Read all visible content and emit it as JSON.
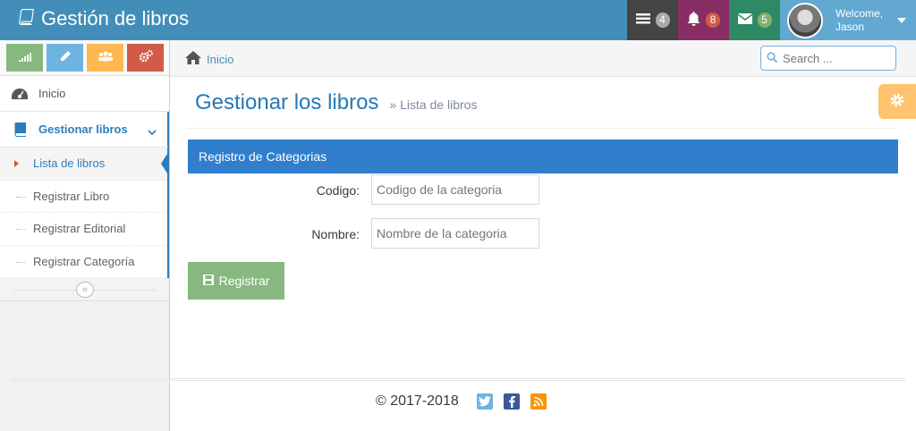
{
  "navbar": {
    "brand": "Gestión de libros",
    "tasks_count": "4",
    "notifications_count": "8",
    "messages_count": "5",
    "welcome": "Welcome,",
    "user_name": "Jason"
  },
  "sidebar": {
    "items": [
      {
        "label": "Inicio",
        "icon": "tachometer-icon"
      },
      {
        "label": "Gestionar libros",
        "icon": "book-icon"
      }
    ],
    "submenu": [
      {
        "label": "Lista de libros"
      },
      {
        "label": "Registrar Libro"
      },
      {
        "label": "Registrar Editorial"
      },
      {
        "label": "Registrar Categoría"
      }
    ]
  },
  "breadcrumb": {
    "home": "Inicio"
  },
  "search": {
    "placeholder": "Search ..."
  },
  "page": {
    "title": "Gestionar los libros",
    "subtitle": "Lista de libros"
  },
  "panel": {
    "title": "Registro de Categorias"
  },
  "form": {
    "codigo_label": "Codigo:",
    "codigo_placeholder": "Codigo de la categoria",
    "nombre_label": "Nombre:",
    "nombre_placeholder": "Nombre de la categoria",
    "submit_label": "Registrar"
  },
  "footer": {
    "copyright": "© 2017-2018"
  },
  "colors": {
    "navbar": "#438eb9",
    "primary": "#307ecc",
    "success": "#87b87f",
    "warning": "#ffb752",
    "danger": "#d15b47"
  }
}
